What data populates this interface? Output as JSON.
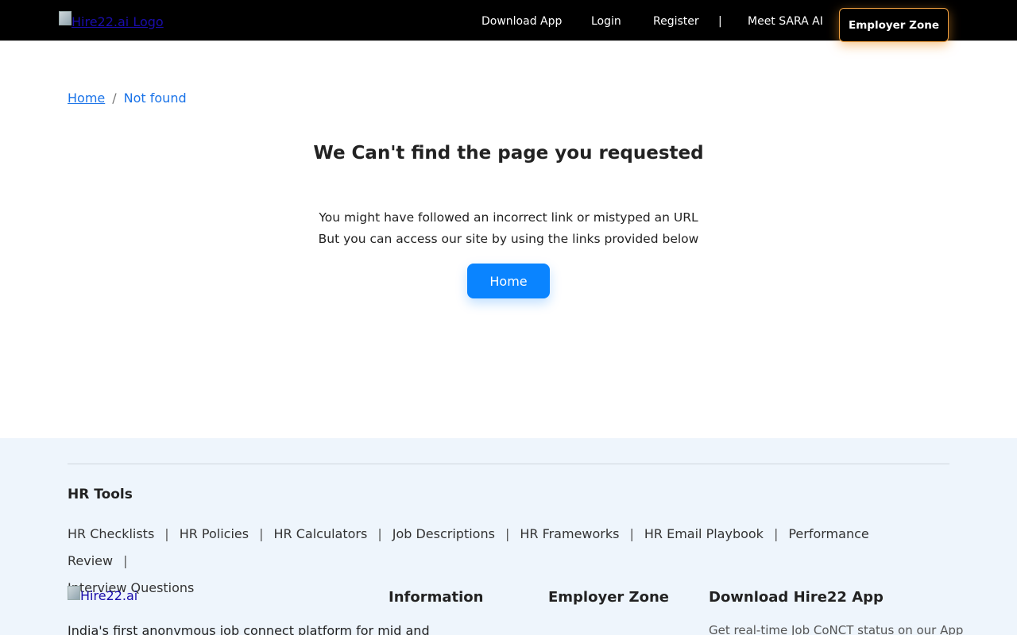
{
  "header": {
    "logo_alt": "Hire22.ai Logo",
    "nav": [
      "Download App",
      "Login",
      "Register",
      "Meet SARA AI"
    ],
    "separator": "|",
    "employer_button": "Employer Zone"
  },
  "breadcrumb": {
    "home": "Home",
    "separator": "/",
    "current": "Not found"
  },
  "main": {
    "title": "We Can't find the page you requested",
    "line1": "You might have followed an incorrect link or mistyped an URL",
    "line2": "But you can access our site by using the links provided below",
    "home_button": "Home"
  },
  "footer": {
    "tools_title": "HR Tools",
    "tools": [
      "HR Checklists",
      "HR Policies",
      "HR Calculators",
      "Job Descriptions",
      "HR Frameworks",
      "HR Email Playbook",
      "Performance Review",
      "Interview Questions"
    ],
    "tool_separator": "|",
    "logo_alt": "Hire22.ai",
    "col_information": "Information",
    "col_employer": "Employer Zone",
    "col_download": "Download Hire22 App",
    "tagline": "India's first anonymous job connect platform for mid and",
    "download_sub": "Get real-time Job CoNCT status on our App"
  },
  "colors": {
    "header_bg": "#000000",
    "accent_blue": "#0a84ff",
    "employer_glow": "#f0a040",
    "footer_bg": "#eef5fc"
  }
}
